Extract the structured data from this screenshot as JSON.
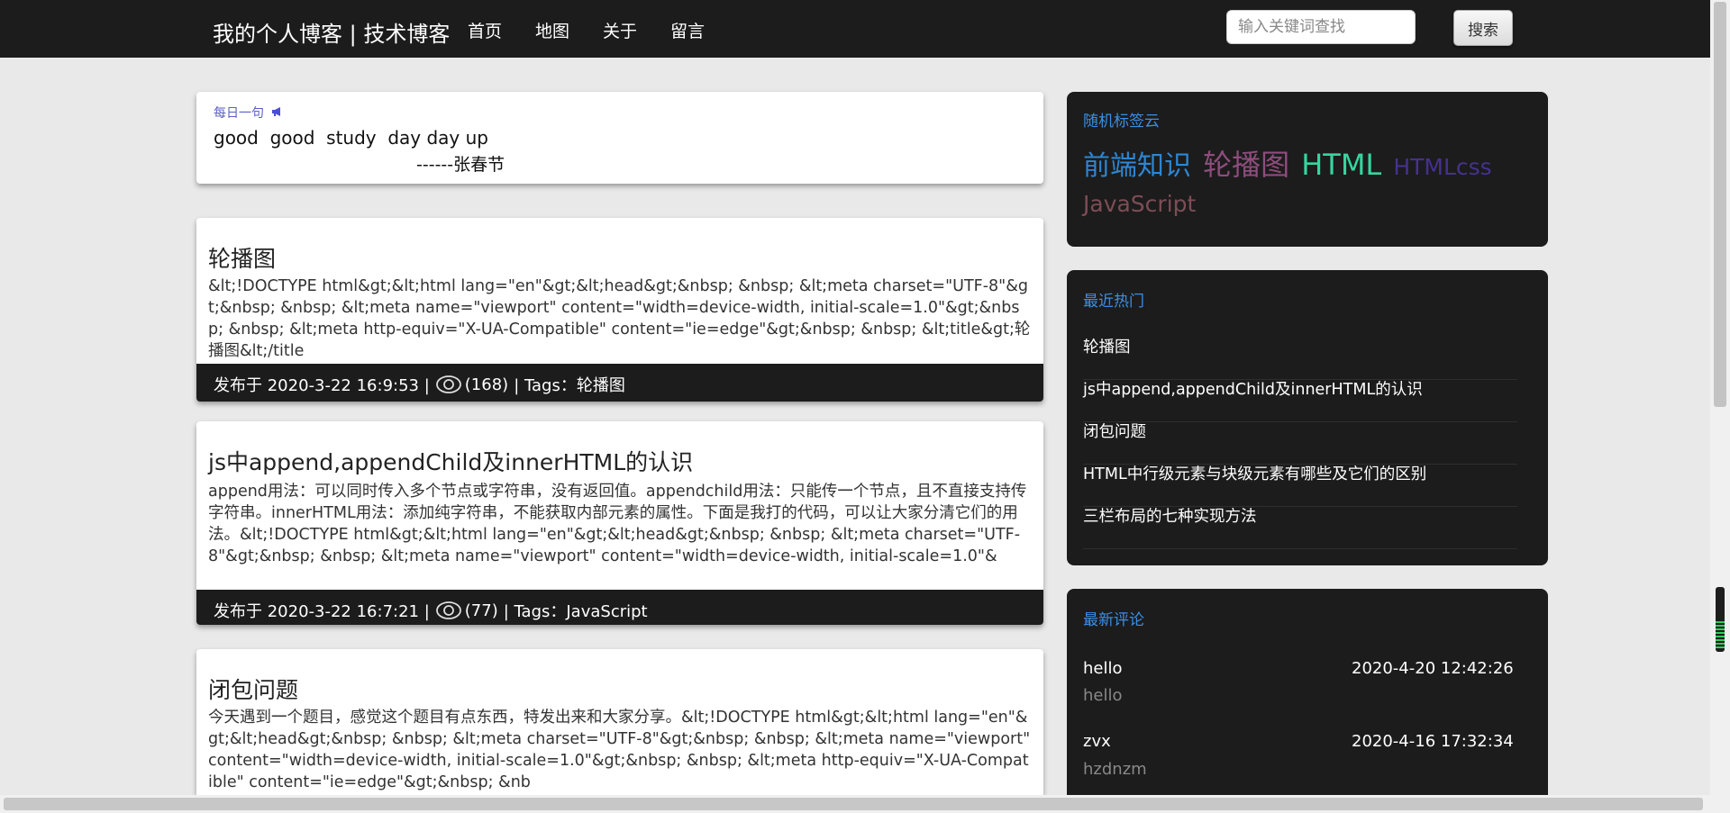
{
  "header": {
    "brand": "我的个人博客 | 技术博客",
    "nav": [
      "首页",
      "地图",
      "关于",
      "留言"
    ],
    "search_placeholder": "输入关键词查找",
    "search_button": "搜索"
  },
  "quote": {
    "title": "每日一句",
    "icon": "megaphone-icon",
    "text": "good  good  study  day day up",
    "author": "------张春节"
  },
  "articles": [
    {
      "title": "轮播图",
      "excerpt": "&lt;!DOCTYPE html&gt;&lt;html lang=\"en\"&gt;&lt;head&gt;&nbsp; &nbsp; &lt;meta charset=\"UTF-8\"&gt;&nbsp; &nbsp; &lt;meta name=\"viewport\" content=\"width=device-width, initial-scale=1.0\"&gt;&nbsp; &nbsp; &lt;meta http-equiv=\"X-UA-Compatible\" content=\"ie=edge\"&gt;&nbsp; &nbsp; &lt;title&gt;轮播图&lt;/title",
      "posted": "发布于 2020-3-22 16:9:53 |",
      "views": "(168)",
      "tags": "| Tags：轮播图"
    },
    {
      "title": "js中append,appendChild及innerHTML的认识",
      "excerpt": "append用法：可以同时传入多个节点或字符串，没有返回值。appendchild用法：只能传一个节点，且不直接支持传字符串。innerHTML用法：添加纯字符串，不能获取内部元素的属性。下面是我打的代码，可以让大家分清它们的用法。&lt;!DOCTYPE html&gt;&lt;html lang=\"en\"&gt;&lt;head&gt;&nbsp; &nbsp; &lt;meta charset=\"UTF-8\"&gt;&nbsp; &nbsp; &lt;meta name=\"viewport\" content=\"width=device-width, initial-scale=1.0\"&",
      "posted": "发布于 2020-3-22 16:7:21 |",
      "views": "(77)",
      "tags": "| Tags：JavaScript"
    },
    {
      "title": "闭包问题",
      "excerpt": "今天遇到一个题目，感觉这个题目有点东西，特发出来和大家分享。&lt;!DOCTYPE html&gt;&lt;html lang=\"en\"&gt;&lt;head&gt;&nbsp; &nbsp; &lt;meta charset=\"UTF-8\"&gt;&nbsp; &nbsp; &lt;meta name=\"viewport\" content=\"width=device-width, initial-scale=1.0\"&gt;&nbsp; &nbsp; &lt;meta http-equiv=\"X-UA-Compatible\" content=\"ie=edge\"&gt;&nbsp; &nb"
    }
  ],
  "sidebar": {
    "tag_cloud": {
      "title": "随机标签云",
      "tags": [
        {
          "label": "前端知识",
          "color": "#2e86d1"
        },
        {
          "label": "轮播图",
          "color": "#8e4d7d"
        },
        {
          "label": "HTML",
          "color": "#35d6a0"
        },
        {
          "label": "HTMLcss",
          "color": "#46318f"
        },
        {
          "label": "JavaScript",
          "color": "#7d4d56"
        }
      ]
    },
    "hot": {
      "title": "最近热门",
      "items": [
        "轮播图",
        "js中append,appendChild及innerHTML的认识",
        "闭包问题",
        "HTML中行级元素与块级元素有哪些及它们的区别",
        "三栏布局的七种实现方法"
      ]
    },
    "comments": {
      "title": "最新评论",
      "items": [
        {
          "name": "hello",
          "time": "2020-4-20 12:42:26",
          "text": "hello"
        },
        {
          "name": "zvx",
          "time": "2020-4-16 17:32:34",
          "text": "hzdnzm"
        }
      ]
    }
  }
}
